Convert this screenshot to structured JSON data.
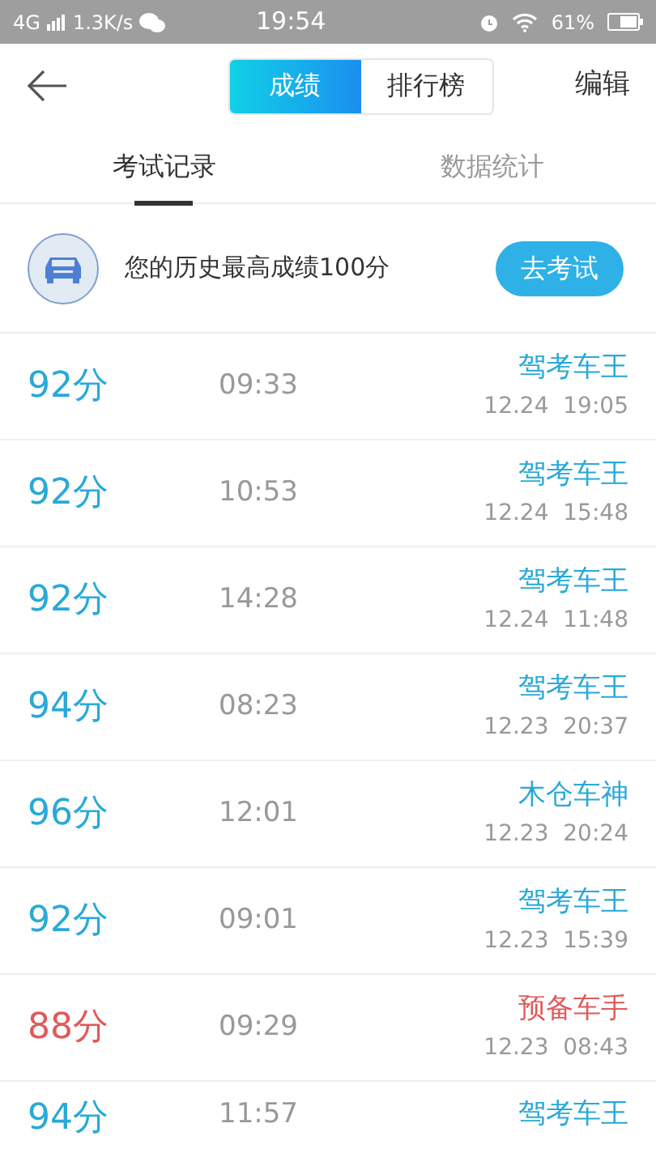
{
  "status_bar": {
    "network": "4G",
    "speed": "1.3K/s",
    "time": "19:54",
    "battery": "61%"
  },
  "header": {
    "segments": [
      {
        "label": "成绩",
        "selected": true
      },
      {
        "label": "排行榜",
        "selected": false
      }
    ],
    "action": "编辑"
  },
  "tabs": [
    {
      "label": "考试记录",
      "selected": true
    },
    {
      "label": "数据统计",
      "selected": false
    }
  ],
  "banner": {
    "text": "您的历史最高成绩100分",
    "button": "去考试"
  },
  "records": [
    {
      "score": "92分",
      "duration": "09:33",
      "title": "驾考车王",
      "date": "12.24  19:05",
      "color": "#29a9d9"
    },
    {
      "score": "92分",
      "duration": "10:53",
      "title": "驾考车王",
      "date": "12.24  15:48",
      "color": "#29a9d9"
    },
    {
      "score": "92分",
      "duration": "14:28",
      "title": "驾考车王",
      "date": "12.24  11:48",
      "color": "#29a9d9"
    },
    {
      "score": "94分",
      "duration": "08:23",
      "title": "驾考车王",
      "date": "12.23  20:37",
      "color": "#29a9d9"
    },
    {
      "score": "96分",
      "duration": "12:01",
      "title": "木仓车神",
      "date": "12.23  20:24",
      "color": "#29a9d9"
    },
    {
      "score": "92分",
      "duration": "09:01",
      "title": "驾考车王",
      "date": "12.23  15:39",
      "color": "#29a9d9"
    },
    {
      "score": "88分",
      "duration": "09:29",
      "title": "预备车手",
      "date": "12.23  08:43",
      "color": "#e05a5a"
    },
    {
      "score": "94分",
      "duration": "11:57",
      "title": "驾考车王",
      "color": "#29a9d9"
    }
  ]
}
